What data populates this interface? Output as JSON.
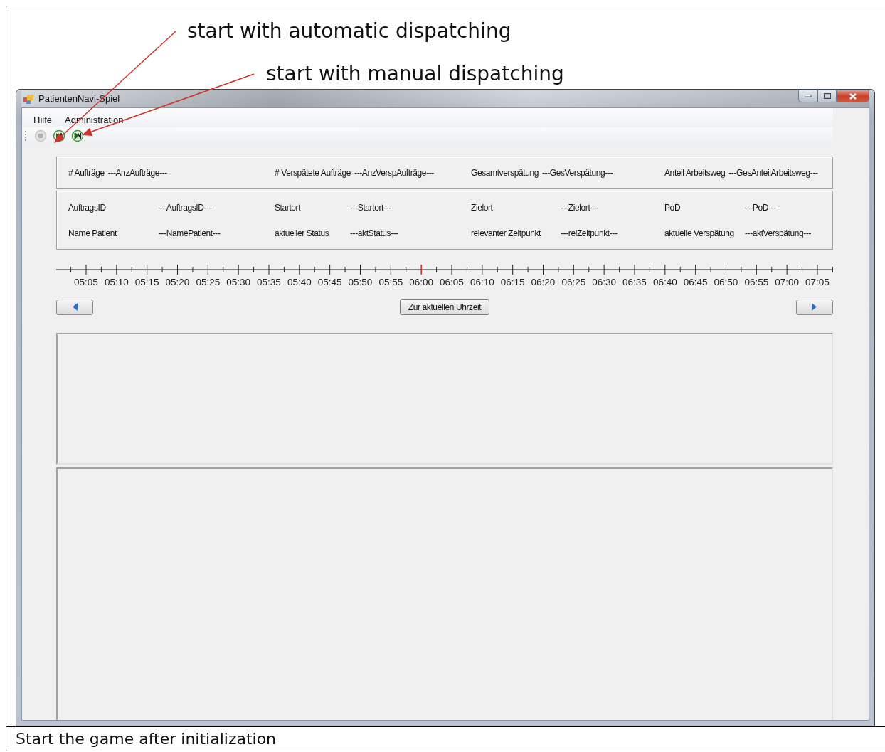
{
  "annotations": [
    {
      "text": "start with automatic dispatching"
    },
    {
      "text": "start with manual dispatching"
    }
  ],
  "window": {
    "title": "PatientenNavi-Spiel"
  },
  "menu": [
    "Hilfe",
    "Administration"
  ],
  "toolbar": [
    {
      "kind": "stop",
      "disabled": true
    },
    {
      "kind": "play_auto",
      "disabled": false
    },
    {
      "kind": "play_manual",
      "disabled": false
    }
  ],
  "summary": [
    {
      "label": "# Aufträge",
      "value": "---AnzAufträge---"
    },
    {
      "label": "# Verspätete Aufträge",
      "value": "---AnzVerspAufträge---"
    },
    {
      "label": "Gesamtverspätung",
      "value": "---GesVerspätung---"
    },
    {
      "label": "Anteil Arbeitsweg",
      "value": "---GesAnteilArbeitsweg---"
    }
  ],
  "details": [
    [
      {
        "label": "AuftragsID",
        "value": "---AuftragsID---"
      },
      {
        "label": "Startort",
        "value": "---Startort---"
      },
      {
        "label": "Zielort",
        "value": "---Zielort---"
      },
      {
        "label": "PoD",
        "value": "---PoD---"
      }
    ],
    [
      {
        "label": "Name Patient",
        "value": "---NamePatient---"
      },
      {
        "label": "aktueller Status",
        "value": "---aktStatus---"
      },
      {
        "label": "relevanter Zeitpunkt",
        "value": "---relZeitpunkt---"
      },
      {
        "label": "aktuelle Verspätung",
        "value": "---aktVerspätung---"
      }
    ]
  ],
  "timeline": {
    "labels": [
      {
        "text": "05:05",
        "current": false
      },
      {
        "text": "05:10",
        "current": false
      },
      {
        "text": "05:15",
        "current": false
      },
      {
        "text": "05:20",
        "current": false
      },
      {
        "text": "05:25",
        "current": false
      },
      {
        "text": "05:30",
        "current": false
      },
      {
        "text": "05:35",
        "current": false
      },
      {
        "text": "05:40",
        "current": false
      },
      {
        "text": "05:45",
        "current": false
      },
      {
        "text": "05:50",
        "current": false
      },
      {
        "text": "05:55",
        "current": false
      },
      {
        "text": "06:00",
        "current": true
      },
      {
        "text": "06:05",
        "current": false
      },
      {
        "text": "06:10",
        "current": false
      },
      {
        "text": "06:15",
        "current": false
      },
      {
        "text": "06:20",
        "current": false
      },
      {
        "text": "06:25",
        "current": false
      },
      {
        "text": "06:30",
        "current": false
      },
      {
        "text": "06:35",
        "current": false
      },
      {
        "text": "06:40",
        "current": false
      },
      {
        "text": "06:45",
        "current": false
      },
      {
        "text": "06:50",
        "current": false
      },
      {
        "text": "06:55",
        "current": false
      },
      {
        "text": "07:00",
        "current": false
      },
      {
        "text": "07:05",
        "current": false
      }
    ]
  },
  "navigation": {
    "center_button": "Zur aktuellen Uhrzeit"
  },
  "caption": "Start the game after initialization"
}
